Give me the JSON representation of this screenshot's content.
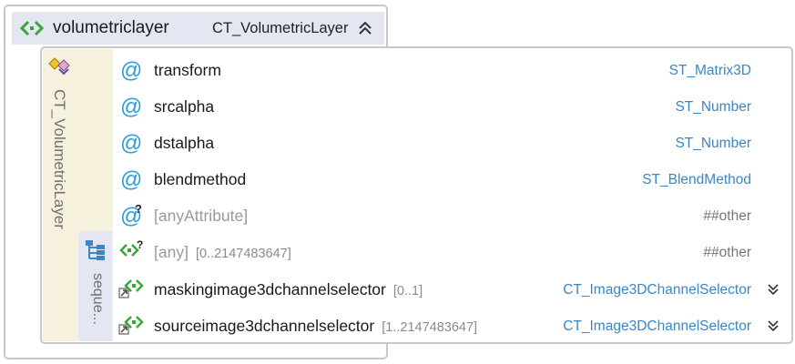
{
  "element": {
    "name": "volumetriclayer",
    "type": "CT_VolumetricLayer",
    "collapse_icon": "double-chevron-up-icon"
  },
  "complex_type": {
    "name": "CT_VolumetricLayer",
    "icon": "complex-type-icon"
  },
  "sequence": {
    "label": "seque..."
  },
  "rows": [
    {
      "kind": "attribute",
      "name": "transform",
      "type": "ST_Matrix3D"
    },
    {
      "kind": "attribute",
      "name": "srcalpha",
      "type": "ST_Number"
    },
    {
      "kind": "attribute",
      "name": "dstalpha",
      "type": "ST_Number"
    },
    {
      "kind": "attribute",
      "name": "blendmethod",
      "type": "ST_BlendMethod"
    },
    {
      "kind": "any-attribute",
      "name": "[anyAttribute]",
      "type": "##other"
    },
    {
      "kind": "any-element",
      "name": "[any]",
      "occurs": "[0..2147483647]",
      "type": "##other"
    },
    {
      "kind": "element",
      "name": "maskingimage3dchannelselector",
      "occurs": "[0..1]",
      "type": "CT_Image3DChannelSelector",
      "expand_icon": "double-chevron-down-icon"
    },
    {
      "kind": "element",
      "name": "sourceimage3dchannelselector",
      "occurs": "[1..2147483647]",
      "type": "CT_Image3DChannelSelector",
      "expand_icon": "double-chevron-down-icon"
    }
  ],
  "colors": {
    "header_bg": "#e4e7f2",
    "type_strip_bg": "#f6f1dc",
    "attribute_icon": "#2b9cd8",
    "element_icon": "#3aa63a",
    "type_link": "#3a86c8",
    "border": "#c8c8c8"
  }
}
